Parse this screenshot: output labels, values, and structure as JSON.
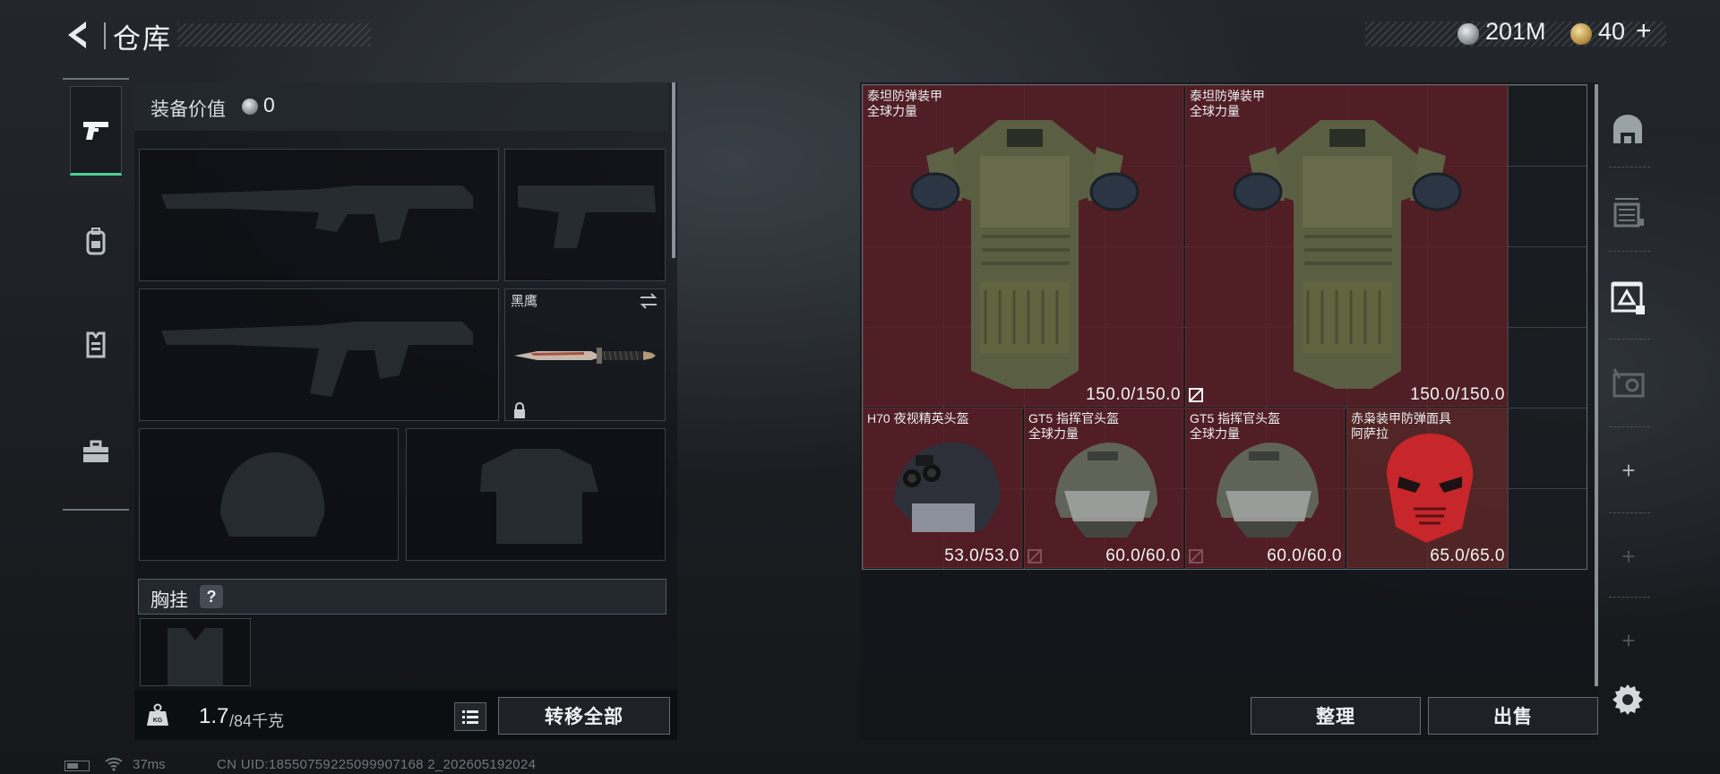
{
  "header": {
    "title": "仓库"
  },
  "currency": {
    "coins": "201M",
    "premium": "40",
    "add": "+"
  },
  "equipment": {
    "value_label": "装备价值",
    "value": "0"
  },
  "knife": {
    "name": "黑鹰"
  },
  "chest_rig": {
    "label": "胸挂",
    "help": "?"
  },
  "weight": {
    "current": "1.7",
    "max": "/84千克"
  },
  "buttons": {
    "transfer_all": "转移全部",
    "tidy": "整理",
    "sell": "出售"
  },
  "stash": {
    "items": [
      {
        "name": "泰坦防弹装甲",
        "sub": "全球力量",
        "durability": "150.0/150.0",
        "broken_icon": true
      },
      {
        "name": "泰坦防弹装甲",
        "sub": "全球力量",
        "durability": "150.0/150.0",
        "broken_icon": false
      },
      {
        "name": "H70 夜视精英头盔",
        "sub": "",
        "durability": "53.0/53.0",
        "broken_icon": true
      },
      {
        "name": "GT5 指挥官头盔",
        "sub": "全球力量",
        "durability": "60.0/60.0",
        "broken_icon": true
      },
      {
        "name": "GT5 指挥官头盔",
        "sub": "全球力量",
        "durability": "60.0/60.0",
        "broken_icon": false
      },
      {
        "name": "赤枭装甲防弹面具",
        "sub": "阿萨拉",
        "durability": "65.0/65.0",
        "broken_icon": false
      }
    ]
  },
  "side_tabs": {
    "plus": "+"
  },
  "status": {
    "ping": "37ms",
    "uid": "CN UID:18550759225099907168 2_202605192024"
  },
  "colors": {
    "accent": "#4fcf95",
    "item_bg": "#601f26",
    "mask_red": "#c7262a"
  },
  "icons": [
    "back-arrow-icon",
    "silver-coin-icon",
    "gold-coin-icon",
    "pistol-icon",
    "backpack-icon",
    "vest-icon",
    "toolbox-icon",
    "swap-icon",
    "lock-icon",
    "weight-icon",
    "list-icon",
    "broken-icon",
    "gear-icon",
    "battery-icon",
    "wifi-icon"
  ]
}
